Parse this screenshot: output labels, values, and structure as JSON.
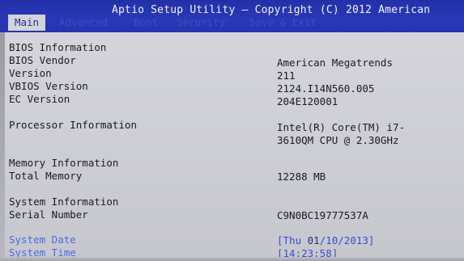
{
  "header": {
    "title": "Aptio Setup Utility – Copyright (C) 2012 American",
    "tabs": [
      "Main",
      "Advanced",
      "Boot",
      "Security",
      "Save & Exit"
    ],
    "active_tab": "Main"
  },
  "bios": {
    "section_title": "BIOS Information",
    "vendor_label": "BIOS Vendor",
    "vendor_value": "American Megatrends",
    "version_label": "Version",
    "version_value": "211",
    "vbios_label": "VBIOS Version",
    "vbios_value": "2124.I14N560.005",
    "ec_label": "EC Version",
    "ec_value": "204E120001"
  },
  "processor": {
    "label": "Processor Information",
    "value_line1": "Intel(R) Core(TM) i7-",
    "value_line2": "3610QM CPU @ 2.30GHz"
  },
  "memory": {
    "section_title": "Memory Information",
    "total_label": "Total Memory",
    "total_value": "12288 MB"
  },
  "system": {
    "section_title": "System Information",
    "serial_label": "Serial Number",
    "serial_value": "C9N0BC19777537A",
    "date_label": "System Date",
    "date_open": "[Thu ",
    "date_highlight": "01",
    "date_rest": "/10/2013]",
    "time_label": "System Time",
    "time_value": "[14:23:58]"
  },
  "colors": {
    "header_bg": "#2634ae",
    "body_bg": "#cfd0d6",
    "selectable_text": "#4a6ae8"
  }
}
